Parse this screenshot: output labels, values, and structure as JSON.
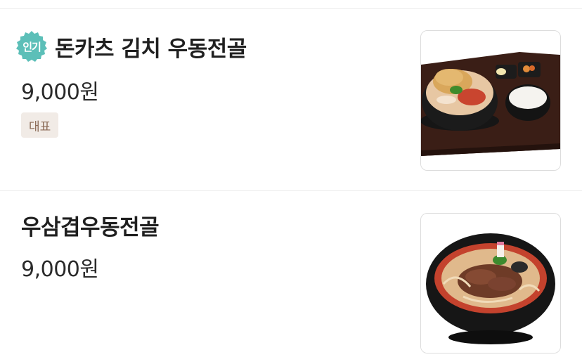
{
  "menu": {
    "items": [
      {
        "badge": "인기",
        "name": "돈카츠 김치 우동전골",
        "price": "9,000원",
        "tag": "대표",
        "image": "tray-set-meal-photo"
      },
      {
        "name": "우삼겹우동전골",
        "price": "9,000원",
        "image": "udon-hotpot-bowl-photo"
      }
    ]
  },
  "colors": {
    "badge": "#5cbfb8",
    "tag_bg": "#f1ebe6",
    "tag_text": "#8a6a55",
    "divider": "#ececec"
  }
}
